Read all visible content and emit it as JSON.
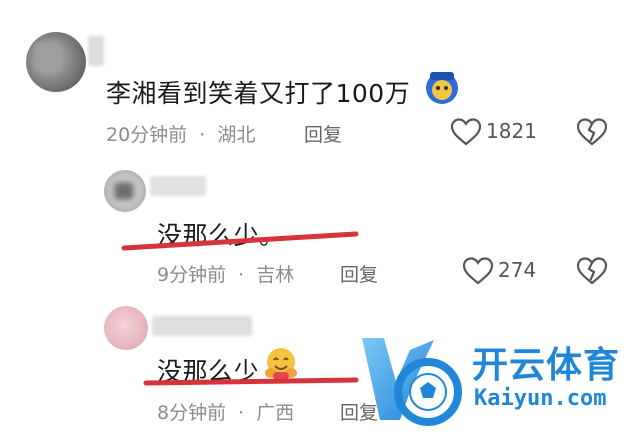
{
  "comments": [
    {
      "text": "李湘看到笑着又打了100万",
      "time": "20分钟前",
      "location": "湖北",
      "reply_label": "回复",
      "likes": "1821"
    },
    {
      "text": "没那么少。",
      "time": "9分钟前",
      "location": "吉林",
      "reply_label": "回复",
      "likes": "274"
    },
    {
      "text": "没那么少",
      "time": "8分钟前",
      "location": "广西",
      "reply_label": "回复"
    }
  ],
  "separator": "·",
  "watermark": {
    "brand": "开云体育",
    "domain": "Kaiyun.com",
    "colors": {
      "primary": "#1f86d8",
      "accent": "#7ec7f5"
    }
  },
  "colors": {
    "underline": "#d8323a"
  },
  "icons": [
    "heart-icon",
    "broken-heart-icon",
    "emoji-icon",
    "hug-emoji-icon"
  ]
}
